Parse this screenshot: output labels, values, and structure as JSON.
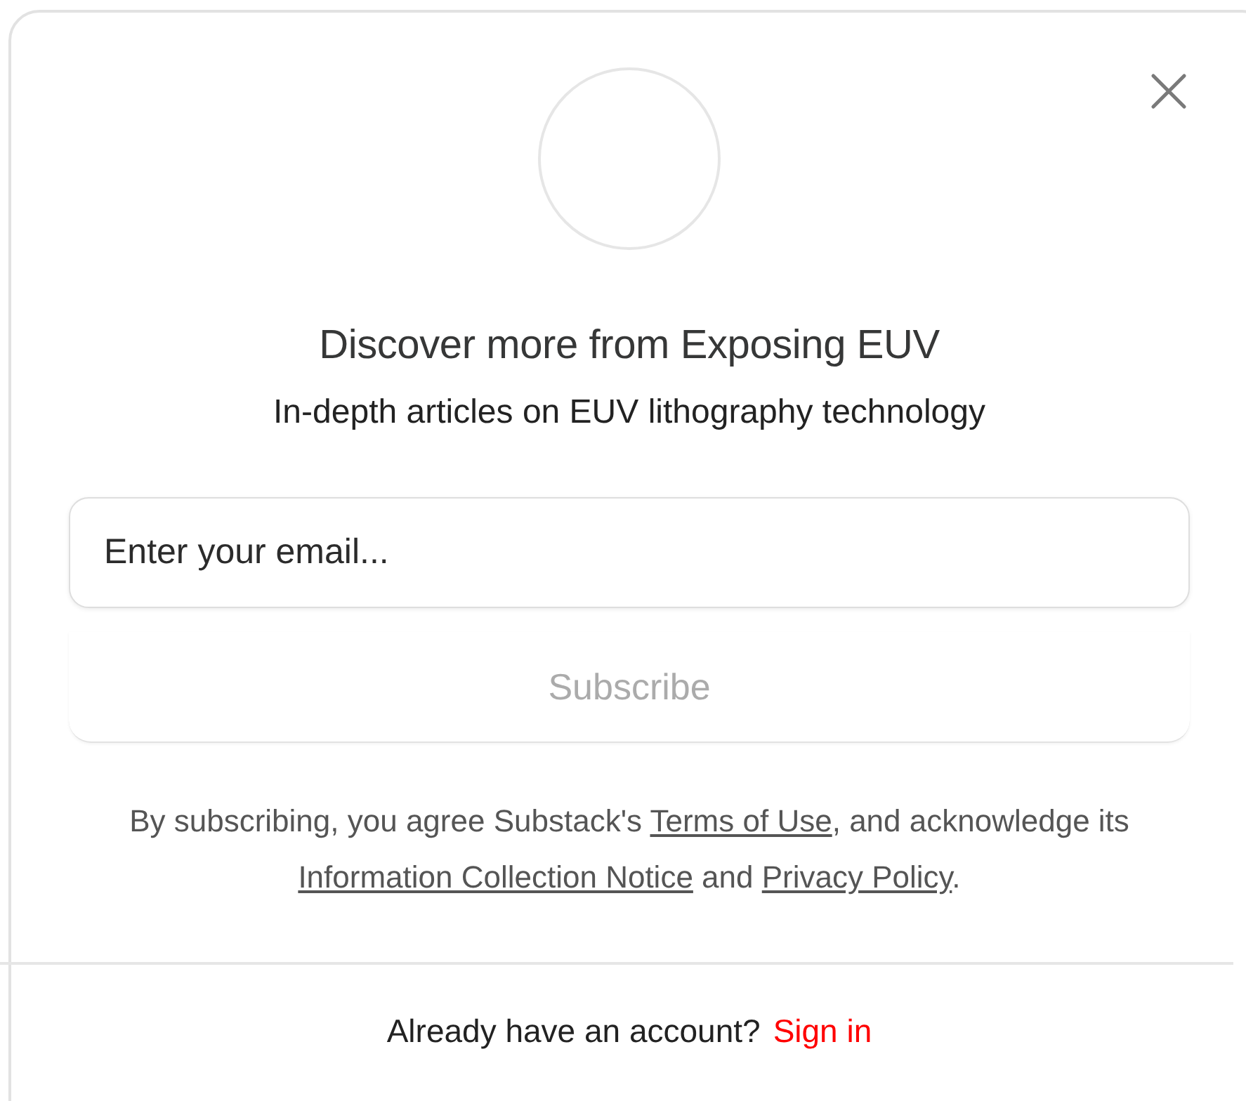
{
  "dialog": {
    "title": "Discover more from Exposing EUV",
    "subtitle": "In-depth articles on EUV lithography technology",
    "email": {
      "placeholder": "Enter your email..."
    },
    "subscribe_button": {
      "label": "Subscribe",
      "disabled": true
    },
    "consent": [
      {
        "kind": "text",
        "text": "By subscribing, you agree Substack's "
      },
      {
        "kind": "link",
        "text": "Terms of Use"
      },
      {
        "kind": "text",
        "text": ", and acknowledge its "
      },
      {
        "kind": "link",
        "text": "Information Collection Notice"
      },
      {
        "kind": "text",
        "text": " and "
      },
      {
        "kind": "link",
        "text": "Privacy Policy"
      },
      {
        "kind": "text",
        "text": "."
      }
    ],
    "footer": {
      "text": "Already have an account?",
      "link": "Sign in"
    }
  }
}
